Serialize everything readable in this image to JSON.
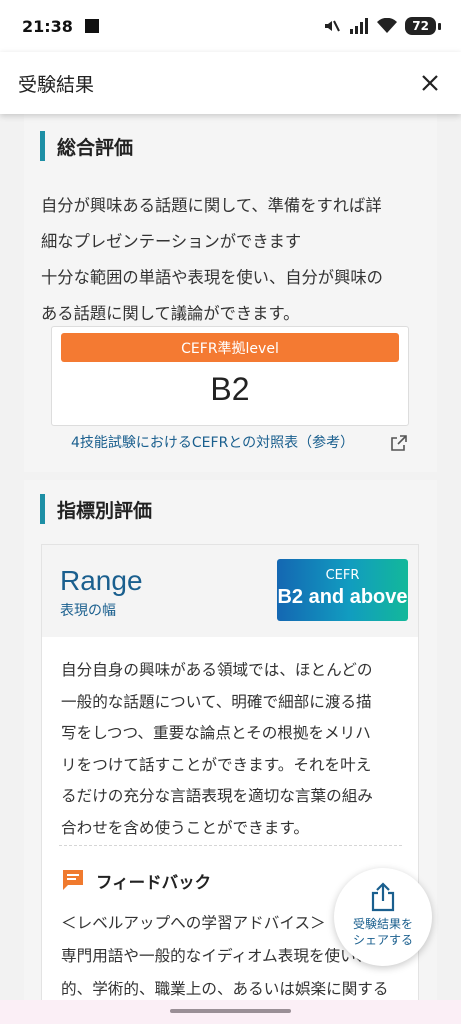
{
  "status_bar": {
    "time": "21:38",
    "battery": "72"
  },
  "header": {
    "title": "受験結果"
  },
  "overall": {
    "section_title": "総合評価",
    "summary_lines": [
      "自分が興味ある話題に関して、準備をすれば詳",
      "細なプレゼンテーションができます",
      "十分な範囲の単語や表現を使い、自分が興味の",
      "ある話題に関して議論ができます。"
    ],
    "cefr_label": "CEFR準拠level",
    "cefr_level": "B2",
    "reference_link": "4技能試験におけるCEFRとの対照表（参考）"
  },
  "indicators": {
    "section_title": "指標別評価",
    "range": {
      "title": "Range",
      "subtitle": "表現の幅",
      "badge_label": "CEFR",
      "badge_value": "B2 and above",
      "description_lines": [
        "自分自身の興味がある領域では、ほとんどの",
        "一般的な話題について、明確で細部に渡る描",
        "写をしつつ、重要な論点とその根拠をメリハ",
        "リをつけて話すことができます。それを叶え",
        "るだけの充分な言語表現を適切な言葉の組み",
        "合わせを含め使うことができます。"
      ],
      "feedback_title": "フィードバック",
      "feedback_lines": [
        "＜レベルアップへの学習アドバイス＞",
        "専門用語や一般的なイディオム表現を使い、一般",
        "的、学術的、職業上の、あるいは娯楽に関する"
      ]
    }
  },
  "share_button": {
    "line1": "受験結果を",
    "line2": "シェアする"
  },
  "colors": {
    "accent_teal": "#1d8fa5",
    "cefr_orange": "#f47a32",
    "link_blue": "#1a5f8e",
    "feedback_orange": "#f07a2e"
  },
  "icons": [
    "mute-icon",
    "signal-icon",
    "wifi-icon",
    "battery-icon",
    "close-icon",
    "external-link-icon",
    "feedback-icon",
    "share-icon"
  ]
}
